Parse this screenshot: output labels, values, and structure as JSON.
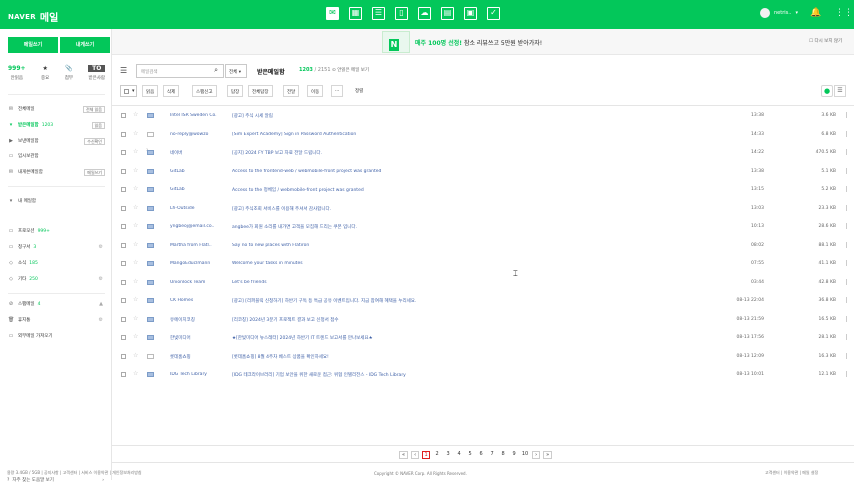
{
  "header": {
    "logo": "NAVER",
    "app_title": "메일",
    "user_name": "netris..",
    "apps": [
      "mail-icon",
      "calendar-icon",
      "contacts-icon",
      "memo-icon",
      "cloud-icon",
      "myfile-icon",
      "office-icon",
      "todo-icon"
    ],
    "accent": "#03c75a"
  },
  "sidebar": {
    "write_button": "메일쓰기",
    "self_button": "내게쓰기",
    "quick": [
      {
        "top": "999+",
        "label": "안읽음"
      },
      {
        "top": "★",
        "label": "중요"
      },
      {
        "top": "📎",
        "label": "첨부"
      },
      {
        "top": "TO",
        "label": "받은사람"
      }
    ],
    "folders": [
      {
        "label": "전체메일",
        "cnt": "",
        "action": "전체 읽음"
      },
      {
        "label": "받은메일함",
        "cnt": "1203",
        "action": "읽음"
      },
      {
        "label": "보낸메일함",
        "cnt": "",
        "action": "수신확인"
      },
      {
        "label": "임시보관함",
        "cnt": "",
        "action": ""
      },
      {
        "label": "내게쓴메일함",
        "cnt": "",
        "action": "메일쓰기"
      }
    ],
    "my_folders_title": "내 메일함",
    "my_folders": [
      {
        "label": "프로모션",
        "cnt": "999+"
      },
      {
        "label": "청구서",
        "cnt": "3"
      },
      {
        "label": "소식",
        "cnt": "185"
      },
      {
        "label": "기타",
        "cnt": "250"
      }
    ],
    "misc": [
      {
        "label": "스팸메일",
        "cnt": "4"
      },
      {
        "label": "휴지통",
        "cnt": ""
      },
      {
        "label": "외부메일 가져오기",
        "cnt": ""
      }
    ],
    "help": "자주 찾는 도움말 보기"
  },
  "ad": {
    "prefix": "매주 100명 선정!",
    "text": "참소 리뷰쓰고 5만원 받아가자!",
    "right": "다시 보지 않기"
  },
  "toolbar": {
    "search_placeholder": "메일검색",
    "search_scope": "전체",
    "folder_title": "받은메일함",
    "folder_count": "1203",
    "folder_total": "/ 2151",
    "folder_note": "안읽은 메일 보기",
    "buttons": [
      "읽음",
      "삭제",
      "스팸신고",
      "답장",
      "전체답장",
      "전달",
      "이동",
      "···",
      "정렬"
    ]
  },
  "mails": [
    {
      "from": "Intel ISR Sweden Co.",
      "subject": "[광고] 주식 시세 알림",
      "date": "13:38",
      "size": "3.6 KB",
      "clip": false,
      "read": false
    },
    {
      "from": "no-reply@wowzo",
      "subject": "[Sim Expert Academy] Sign in Password Authentication",
      "date": "14:33",
      "size": "6.8 KB",
      "clip": false,
      "read": true
    },
    {
      "from": "네이버",
      "subject": "[공지] 2024 FY TBP 보고 자료 전달 드립니다.",
      "date": "14:22",
      "size": "470.5 KB",
      "clip": true,
      "read": false
    },
    {
      "from": "GitLab",
      "subject": "Access to the frontend-web / webmobile-front project was granted",
      "date": "13:38",
      "size": "5.1 KB",
      "clip": false,
      "read": false
    },
    {
      "from": "GitLab",
      "subject": "Access to the 정체임 / webmobile-front project was granted",
      "date": "13:15",
      "size": "5.2 KB",
      "clip": false,
      "read": false
    },
    {
      "from": "Lh-Outside",
      "subject": "[광고] 주식조회 서비스를 이용해 주셔서 감사합니다.",
      "date": "13:03",
      "size": "23.3 KB",
      "clip": false,
      "read": false
    },
    {
      "from": "yngbeoj@email.co..",
      "subject": "angbee가 회원 소리를 내가면 고객을 모집해 드리는 쿠폰 입니다.",
      "date": "10:13",
      "size": "28.6 KB",
      "clip": false,
      "read": false
    },
    {
      "from": "Martha from Flatl..",
      "subject": "Say no to new places with Flatiron",
      "date": "08:02",
      "size": "88.1 KB",
      "clip": false,
      "read": false
    },
    {
      "from": "MangoEduclmann",
      "subject": "Welcome your tasks in minutes",
      "date": "07:55",
      "size": "41.1 KB",
      "clip": false,
      "read": false
    },
    {
      "from": "Unionlock Team",
      "subject": "Let's be friends",
      "date": "03:44",
      "size": "42.8 KB",
      "clip": false,
      "read": false
    },
    {
      "from": "CK Homes",
      "subject": "[광고] [리퍼블릭 신청하기] 하반기 구독 등 특급 공유 이벤트입니다. 지금 참여해 혜택을 누리세요.",
      "date": "08-13 22:04",
      "size": "36.8 KB",
      "clip": false,
      "read": false
    },
    {
      "from": "유에이치코칭",
      "subject": "[리코칭] 2024년 3분기 프로젝트 결과 보고 신청서 접수",
      "date": "08-13 21:59",
      "size": "16.5 KB",
      "clip": false,
      "read": false
    },
    {
      "from": "한빛미디어",
      "subject": "★[한빛미디어 뉴스레터] 2024년 하반기 IT 트렌드 보고서를 만나보세요★",
      "date": "08-13 17:56",
      "size": "28.1 KB",
      "clip": false,
      "read": false
    },
    {
      "from": "롯데홈쇼핑",
      "subject": "[롯데홈쇼핑] 8월 4주차 베스트 상품을 확인하세요!",
      "date": "08-13 12:09",
      "size": "16.3 KB",
      "clip": false,
      "read": true
    },
    {
      "from": "IDG Tech Library",
      "subject": "[IDG 테크라이브러리] 기업 보안을 위한 새로운 접근: 위협 인텔리전스 - IDG Tech Library",
      "date": "08-13 10:01",
      "size": "12.1 KB",
      "clip": false,
      "read": false
    }
  ],
  "pager": {
    "pages": [
      "1",
      "2",
      "3",
      "4",
      "5",
      "6",
      "7",
      "8",
      "9",
      "10"
    ],
    "current": "1",
    "prev": "‹",
    "next": "›",
    "first": "«",
    "last": "»"
  },
  "footer": {
    "left": "용량 3.4GB / 5GB | 공지사항 | 고객센터 | 서비스 이용약관 | 개인정보처리방침",
    "center": "Copyright © NAVER Corp. All Rights Reserved.",
    "right": "고객센터 | 이용약관 | 메일 설정"
  }
}
